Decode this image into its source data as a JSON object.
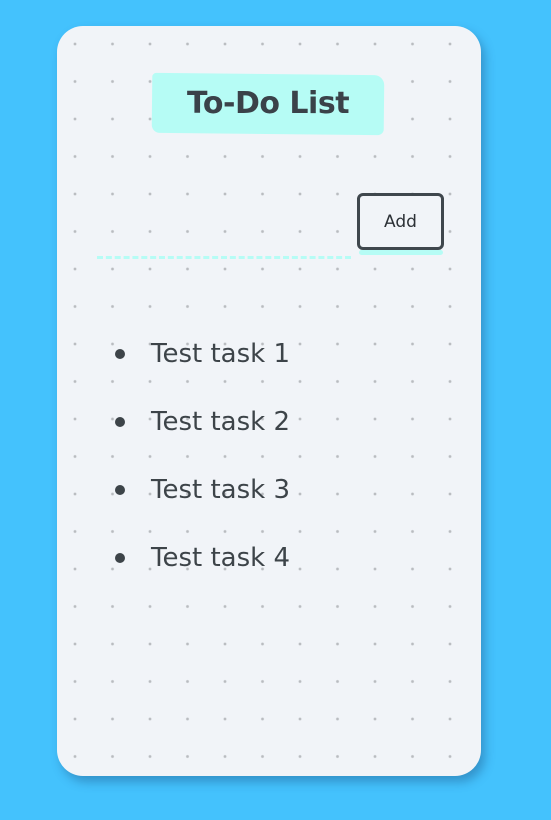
{
  "app": {
    "title": "To-Do List"
  },
  "input": {
    "value": "",
    "placeholder": ""
  },
  "add_button": {
    "label": "Add"
  },
  "tasks": [
    {
      "label": "Test task 1"
    },
    {
      "label": "Test task 2"
    },
    {
      "label": "Test task 3"
    },
    {
      "label": "Test task 4"
    }
  ],
  "colors": {
    "background": "#44c2fd",
    "card": "#f1f4f8",
    "highlight": "#b6fcf5",
    "text": "#3d4449",
    "dot_grid": "#b9bcc0"
  }
}
